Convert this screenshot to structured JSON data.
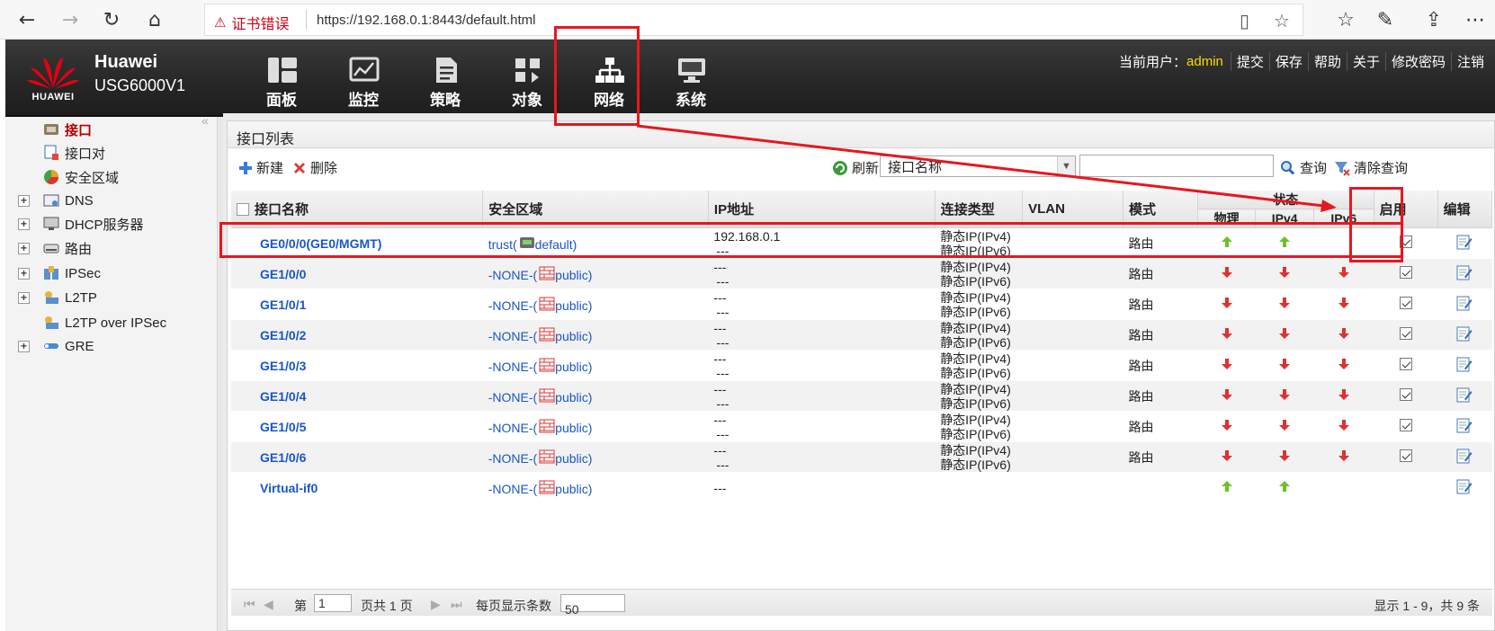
{
  "browser": {
    "cert_warning": "证书错误",
    "url": "https://192.168.0.1:8443/default.html"
  },
  "header": {
    "brand_name": "Huawei",
    "model": "USG6000V1",
    "logo_text": "HUAWEI",
    "nav": [
      {
        "label": "面板",
        "icon": "dashboard-icon"
      },
      {
        "label": "监控",
        "icon": "monitor-icon"
      },
      {
        "label": "策略",
        "icon": "policy-icon"
      },
      {
        "label": "对象",
        "icon": "object-icon"
      },
      {
        "label": "网络",
        "icon": "network-icon"
      },
      {
        "label": "系统",
        "icon": "system-icon"
      }
    ],
    "user_label": "当前用户：",
    "user_name": "admin",
    "links": [
      "提交",
      "保存",
      "帮助",
      "关于",
      "修改密码",
      "注销"
    ]
  },
  "sidebar": {
    "items": [
      {
        "label": "接口",
        "icon": "interface-icon",
        "expandable": false,
        "active": true
      },
      {
        "label": "接口对",
        "icon": "interface-pair-icon",
        "expandable": false,
        "active": false
      },
      {
        "label": "安全区域",
        "icon": "security-zone-icon",
        "expandable": false,
        "active": false
      },
      {
        "label": "DNS",
        "icon": "dns-icon",
        "expandable": true,
        "active": false
      },
      {
        "label": "DHCP服务器",
        "icon": "dhcp-icon",
        "expandable": true,
        "active": false
      },
      {
        "label": "路由",
        "icon": "route-icon",
        "expandable": true,
        "active": false
      },
      {
        "label": "IPSec",
        "icon": "ipsec-icon",
        "expandable": true,
        "active": false
      },
      {
        "label": "L2TP",
        "icon": "l2tp-icon",
        "expandable": true,
        "active": false
      },
      {
        "label": "L2TP over IPSec",
        "icon": "l2tp-ipsec-icon",
        "expandable": false,
        "active": false
      },
      {
        "label": "GRE",
        "icon": "gre-icon",
        "expandable": true,
        "active": false
      }
    ]
  },
  "panel": {
    "title": "接口列表",
    "toolbar": {
      "new": "新建",
      "delete": "删除",
      "refresh": "刷新",
      "filter_field": "接口名称",
      "search_value": "",
      "query": "查询",
      "clear_query": "清除查询"
    },
    "columns": {
      "name": "接口名称",
      "zone": "安全区域",
      "ip": "IP地址",
      "conn_type": "连接类型",
      "vlan": "VLAN",
      "mode": "模式",
      "status": "状态",
      "physical": "物理",
      "ipv4": "IPv4",
      "ipv6": "IPv6",
      "enable": "启用",
      "edit": "编辑"
    },
    "rows": [
      {
        "name": "GE0/0/0(GE0/MGMT)",
        "zone_prefix": "trust(",
        "zone_suffix": "default)",
        "zone_icon": "zone-default-icon",
        "ip1": "192.168.0.1",
        "ip2": "---",
        "type1": "静态IP(IPv4)",
        "type2": "静态IP(IPv6)",
        "vlan": "",
        "mode": "路由",
        "phys": "up",
        "ipv4": "up",
        "ipv6": "",
        "enabled": true
      },
      {
        "name": "GE1/0/0",
        "zone_prefix": "-NONE-(",
        "zone_suffix": "public)",
        "zone_icon": "zone-public-icon",
        "ip1": "---",
        "ip2": "---",
        "type1": "静态IP(IPv4)",
        "type2": "静态IP(IPv6)",
        "vlan": "",
        "mode": "路由",
        "phys": "down",
        "ipv4": "down",
        "ipv6": "down",
        "enabled": true
      },
      {
        "name": "GE1/0/1",
        "zone_prefix": "-NONE-(",
        "zone_suffix": "public)",
        "zone_icon": "zone-public-icon",
        "ip1": "---",
        "ip2": "---",
        "type1": "静态IP(IPv4)",
        "type2": "静态IP(IPv6)",
        "vlan": "",
        "mode": "路由",
        "phys": "down",
        "ipv4": "down",
        "ipv6": "down",
        "enabled": true
      },
      {
        "name": "GE1/0/2",
        "zone_prefix": "-NONE-(",
        "zone_suffix": "public)",
        "zone_icon": "zone-public-icon",
        "ip1": "---",
        "ip2": "---",
        "type1": "静态IP(IPv4)",
        "type2": "静态IP(IPv6)",
        "vlan": "",
        "mode": "路由",
        "phys": "down",
        "ipv4": "down",
        "ipv6": "down",
        "enabled": true
      },
      {
        "name": "GE1/0/3",
        "zone_prefix": "-NONE-(",
        "zone_suffix": "public)",
        "zone_icon": "zone-public-icon",
        "ip1": "---",
        "ip2": "---",
        "type1": "静态IP(IPv4)",
        "type2": "静态IP(IPv6)",
        "vlan": "",
        "mode": "路由",
        "phys": "down",
        "ipv4": "down",
        "ipv6": "down",
        "enabled": true
      },
      {
        "name": "GE1/0/4",
        "zone_prefix": "-NONE-(",
        "zone_suffix": "public)",
        "zone_icon": "zone-public-icon",
        "ip1": "---",
        "ip2": "---",
        "type1": "静态IP(IPv4)",
        "type2": "静态IP(IPv6)",
        "vlan": "",
        "mode": "路由",
        "phys": "down",
        "ipv4": "down",
        "ipv6": "down",
        "enabled": true
      },
      {
        "name": "GE1/0/5",
        "zone_prefix": "-NONE-(",
        "zone_suffix": "public)",
        "zone_icon": "zone-public-icon",
        "ip1": "---",
        "ip2": "---",
        "type1": "静态IP(IPv4)",
        "type2": "静态IP(IPv6)",
        "vlan": "",
        "mode": "路由",
        "phys": "down",
        "ipv4": "down",
        "ipv6": "down",
        "enabled": true
      },
      {
        "name": "GE1/0/6",
        "zone_prefix": "-NONE-(",
        "zone_suffix": "public)",
        "zone_icon": "zone-public-icon",
        "ip1": "---",
        "ip2": "---",
        "type1": "静态IP(IPv4)",
        "type2": "静态IP(IPv6)",
        "vlan": "",
        "mode": "路由",
        "phys": "down",
        "ipv4": "down",
        "ipv6": "down",
        "enabled": true
      },
      {
        "name": "Virtual-if0",
        "zone_prefix": "-NONE-(",
        "zone_suffix": "public)",
        "zone_icon": "zone-public-icon",
        "ip1": "---",
        "ip2": "",
        "type1": "",
        "type2": "",
        "vlan": "",
        "mode": "",
        "phys": "up",
        "ipv4": "up",
        "ipv6": "",
        "enabled": null
      }
    ],
    "pager": {
      "page_prefix": "第",
      "page_value": "1",
      "page_suffix": "页共 1 页",
      "per_page_label": "每页显示条数",
      "per_page_value": "50",
      "summary": "显示 1 - 9，共 9 条"
    }
  },
  "colors": {
    "annotation_red": "#e8161f",
    "link_blue": "#1a56c8",
    "status_up": "#6fbf2a",
    "status_down": "#e03030",
    "active_sidebar": "#b00000",
    "user_name": "#ffd800"
  }
}
